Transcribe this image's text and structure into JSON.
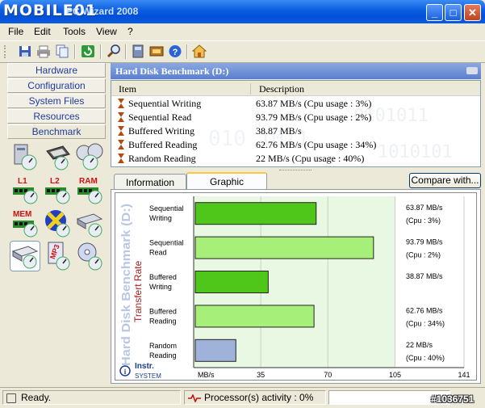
{
  "window": {
    "watermark": "MOBILE01",
    "title": "PC Wizard 2008",
    "buttons": {
      "minimize": "_",
      "maximize": "□",
      "close": "✕"
    }
  },
  "menu": [
    "File",
    "Edit",
    "Tools",
    "View",
    "?"
  ],
  "toolbar": {
    "icons": [
      "save-icon",
      "print-icon",
      "copy-icon",
      "refresh-icon",
      "search-icon",
      "cpu-icon",
      "hardware-icon",
      "help-icon",
      "home-icon"
    ]
  },
  "nav": [
    {
      "label": "Hardware",
      "active": false
    },
    {
      "label": "Configuration",
      "active": false
    },
    {
      "label": "System Files",
      "active": false
    },
    {
      "label": "Resources",
      "active": false
    },
    {
      "label": "Benchmark",
      "active": true
    }
  ],
  "benchmark_icons": [
    {
      "name": "system-benchmark-icon",
      "label": ""
    },
    {
      "name": "cpu-benchmark-icon",
      "label": ""
    },
    {
      "name": "multi-cpu-benchmark-icon",
      "label": ""
    },
    {
      "name": "l1-cache-icon",
      "label": "L1"
    },
    {
      "name": "l2-cache-icon",
      "label": "L2"
    },
    {
      "name": "ram-icon",
      "label": "RAM"
    },
    {
      "name": "mem-icon",
      "label": "MEM"
    },
    {
      "name": "video-icon",
      "label": ""
    },
    {
      "name": "removable-icon",
      "label": ""
    },
    {
      "name": "hard-disk-icon",
      "label": "",
      "selected": true
    },
    {
      "name": "mp3-icon",
      "label": "MP3"
    },
    {
      "name": "cdrom-icon",
      "label": ""
    }
  ],
  "panel": {
    "header": "Hard Disk Benchmark (D:)",
    "columns": {
      "item": "Item",
      "description": "Description"
    },
    "rows": [
      {
        "item": "Sequential Writing",
        "description": "63.87 MB/s (Cpu usage : 3%)"
      },
      {
        "item": "Sequential Read",
        "description": "93.79 MB/s (Cpu usage : 2%)"
      },
      {
        "item": "Buffered Writing",
        "description": "38.87 MB/s"
      },
      {
        "item": "Buffered Reading",
        "description": "62.76 MB/s (Cpu usage : 34%)"
      },
      {
        "item": "Random Reading",
        "description": "22 MB/s (Cpu usage : 40%)"
      }
    ]
  },
  "tabs": [
    {
      "label": "Information",
      "active": false
    },
    {
      "label": "Graphic",
      "active": true
    }
  ],
  "compare_button": "Compare with...",
  "chart_data": {
    "type": "bar",
    "orientation": "horizontal",
    "title": "Hard Disk Benchmark (D:)",
    "subtitle": "Transfert Rate",
    "categories": [
      "Sequential Writing",
      "Sequential Read",
      "Buffered Writing",
      "Buffered Reading",
      "Random Reading"
    ],
    "category_lines": [
      [
        "Sequential",
        "Writing"
      ],
      [
        "Sequential",
        "Read"
      ],
      [
        "Buffered",
        "Writing"
      ],
      [
        "Buffered",
        "Reading"
      ],
      [
        "Random",
        "Reading"
      ]
    ],
    "values": [
      63.87,
      93.79,
      38.87,
      62.76,
      22
    ],
    "value_labels": [
      [
        "63.87  MB/s",
        "(Cpu : 3%)"
      ],
      [
        "93.79  MB/s",
        "(Cpu : 2%)"
      ],
      [
        "38.87  MB/s",
        ""
      ],
      [
        "62.76  MB/s",
        "(Cpu : 34%)"
      ],
      [
        "22 MB/s",
        "(Cpu : 40%)"
      ]
    ],
    "bar_colors": [
      "#4ec61a",
      "#a6f07a",
      "#4ec61a",
      "#a6f07a",
      "#9fb2d9"
    ],
    "xlabel": "MB/s",
    "xticks": [
      35,
      70,
      105,
      141
    ],
    "xlim": [
      0,
      141
    ],
    "grid": true,
    "shaded_region_end": 105,
    "brand": {
      "line1": "Instr.",
      "line2": "SYSTEM"
    }
  },
  "status": {
    "ready": "Ready.",
    "activity": "Processor(s) activity : 0%",
    "watermark": "#1036751"
  }
}
